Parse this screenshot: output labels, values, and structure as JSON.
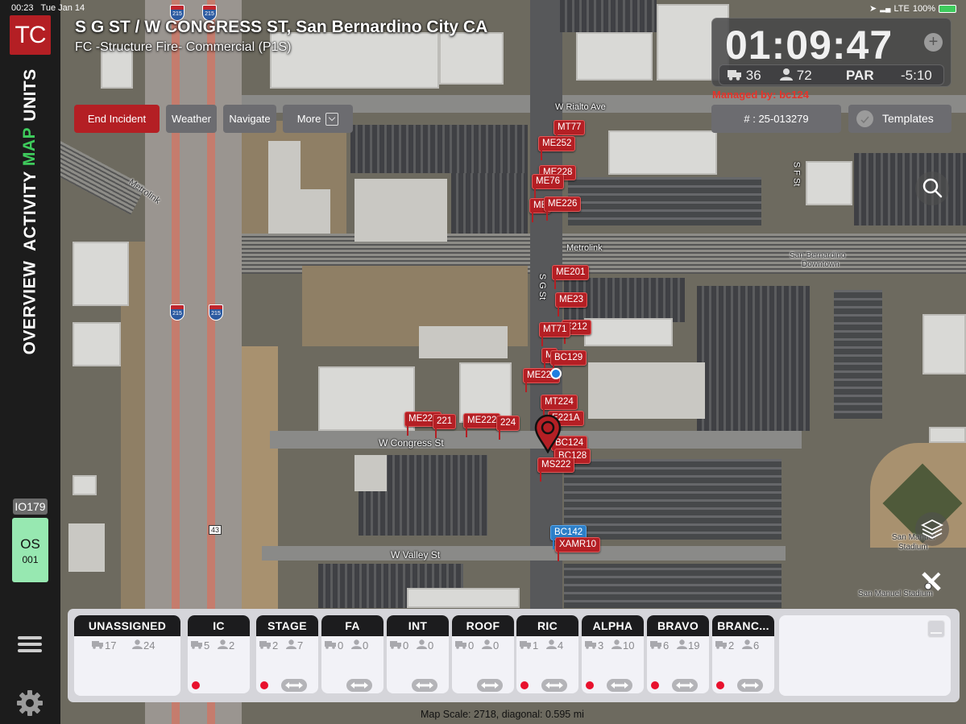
{
  "status_bar": {
    "time": "00:23",
    "date": "Tue Jan 14",
    "network": "LTE",
    "battery": "100%"
  },
  "app": {
    "logo": "TC"
  },
  "rail": {
    "nav": [
      {
        "label": "UNITS",
        "active": false
      },
      {
        "label": "MAP",
        "active": true
      },
      {
        "label": "ACTIVITY",
        "active": false
      },
      {
        "label": "OVERVIEW",
        "active": false
      }
    ],
    "io_badge": "IO179",
    "os_tile": {
      "line1": "OS",
      "line2": "001"
    }
  },
  "incident": {
    "address": "S G ST / W CONGRESS ST, San Bernardino City CA",
    "type": "FC -Structure Fire- Commercial (P1S)",
    "number": "# : 25-013279",
    "managed_by": "Managed by: bc124"
  },
  "toolbar": {
    "end_incident": "End Incident",
    "weather": "Weather",
    "navigate": "Navigate",
    "more": "More"
  },
  "timer": {
    "elapsed": "01:09:47",
    "apparatus_count": "36",
    "personnel_count": "72",
    "par_label": "PAR",
    "par_timer": "-5:10"
  },
  "templates": {
    "label": "Templates"
  },
  "map": {
    "labels": {
      "rialto": "W Rialto Ave",
      "congress": "W Congress St",
      "valley": "W Valley St",
      "metrolink_1": "Metrolink",
      "metrolink_2": "Metrolink",
      "sg_st": "S G St",
      "sf_st": "S F St",
      "station_1": "San Bernardino",
      "station_2": "Downtown",
      "stadium_1": "San Manuel",
      "stadium_2": "Stadium",
      "stadium_b": "San Manuel Stadium",
      "i215": "215",
      "route43": "43"
    },
    "markers": [
      {
        "id": "MT77",
        "color": "red"
      },
      {
        "id": "ME252",
        "color": "red"
      },
      {
        "id": "ME228",
        "color": "red"
      },
      {
        "id": "ME76",
        "color": "red"
      },
      {
        "id": "ME",
        "color": "red"
      },
      {
        "id": "ME226",
        "color": "red"
      },
      {
        "id": "ME201",
        "color": "red"
      },
      {
        "id": "ME23",
        "color": "red"
      },
      {
        "id": "E212",
        "color": "red"
      },
      {
        "id": "MT71",
        "color": "red"
      },
      {
        "id": "M",
        "color": "red"
      },
      {
        "id": "BC129",
        "color": "red"
      },
      {
        "id": "ME221",
        "color": "red"
      },
      {
        "id": "MT224",
        "color": "red"
      },
      {
        "id": "E221A",
        "color": "red"
      },
      {
        "id": "ME221",
        "color": "red"
      },
      {
        "id": "221",
        "color": "red"
      },
      {
        "id": "ME222",
        "color": "red"
      },
      {
        "id": "224",
        "color": "red"
      },
      {
        "id": "BC124",
        "color": "red"
      },
      {
        "id": "BC128",
        "color": "red"
      },
      {
        "id": "MS222",
        "color": "red"
      },
      {
        "id": "BC142",
        "color": "blue"
      },
      {
        "id": "XAMR10",
        "color": "red"
      }
    ],
    "scale_text": "Map Scale: 2718, diagonal: 0.595 mi"
  },
  "groups": [
    {
      "name": "UNASSIGNED",
      "apparatus": "17",
      "personnel": "24",
      "alert": false,
      "swap": false
    },
    {
      "name": "IC",
      "apparatus": "5",
      "personnel": "2",
      "alert": true,
      "swap": false
    },
    {
      "name": "STAGE",
      "apparatus": "2",
      "personnel": "7",
      "alert": true,
      "swap": true
    },
    {
      "name": "FA",
      "apparatus": "0",
      "personnel": "0",
      "alert": false,
      "swap": true
    },
    {
      "name": "INT",
      "apparatus": "0",
      "personnel": "0",
      "alert": false,
      "swap": true
    },
    {
      "name": "ROOF",
      "apparatus": "0",
      "personnel": "0",
      "alert": false,
      "swap": true
    },
    {
      "name": "RIC",
      "apparatus": "1",
      "personnel": "4",
      "alert": true,
      "swap": true
    },
    {
      "name": "ALPHA",
      "apparatus": "3",
      "personnel": "10",
      "alert": true,
      "swap": true
    },
    {
      "name": "BRAVO",
      "apparatus": "6",
      "personnel": "19",
      "alert": true,
      "swap": true
    },
    {
      "name": "BRANC...",
      "apparatus": "2",
      "personnel": "6",
      "alert": true,
      "swap": true
    }
  ],
  "colors": {
    "brand_red": "#b41f24",
    "active_nav": "#3ecb5c",
    "os_tile": "#97e8b1",
    "alert_dot": "#e8112d",
    "managed_text": "#e5332a",
    "marker_blue": "#2d7fc8"
  }
}
